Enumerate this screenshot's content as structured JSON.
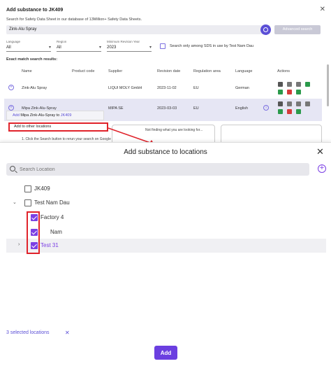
{
  "background": {
    "title": "Add substance to JK409",
    "subtitle": "Search for Safety Data Sheet in our database of 13Million+ Safety Data Sheets.",
    "search_value": "Zink-Alu Spray",
    "advanced_search_label": "Advanced search",
    "filters": [
      {
        "label": "Language",
        "value": "All"
      },
      {
        "label": "Region",
        "value": "All"
      },
      {
        "label": "Minimum Revision Year",
        "value": "2023"
      }
    ],
    "only_sds_label": "Search only among SDS in use by Test Nam Dau",
    "exact_match_label": "Exact match search results:",
    "table_headers": [
      "Name",
      "Product code",
      "Supplier",
      "Revision date",
      "Regulation area",
      "Language",
      "Actions"
    ],
    "rows": [
      {
        "name": "Zink-Alu Spray",
        "product_code": "",
        "supplier": "LIQUI MOLY GmbH",
        "revision_date": "2023-11-02",
        "regulation_area": "EU",
        "language": "German"
      },
      {
        "name": "Mipa Zink-Alu-Spray",
        "product_code": "",
        "supplier": "MIPA SE",
        "revision_date": "2023-03-03",
        "regulation_area": "EU",
        "language": "English"
      }
    ],
    "menu_add_prefix": "Add",
    "menu_add_substance": "Mipa Zink-Alu-Spray to",
    "menu_add_target": "JK409",
    "add_to_other_locations": "Add to other locations",
    "search_hint": "1. Click the Search button to rerun your search on Google",
    "not_finding": "Not finding what you are looking for..."
  },
  "dialog": {
    "title": "Add substance to locations",
    "search_placeholder": "Search Location",
    "tree": [
      {
        "label": "JK409",
        "checked": false,
        "expanded": null
      },
      {
        "label": "Test Nam Dau",
        "checked": false,
        "expanded": true
      },
      {
        "label": "Factory 4",
        "checked": true,
        "expanded": null
      },
      {
        "label": "Nam",
        "checked": true,
        "expanded": null
      },
      {
        "label": "Test 31",
        "checked": true,
        "expanded": false
      }
    ],
    "selected_count_label": "3 selected locations",
    "add_button_label": "Add"
  },
  "colors": {
    "accent": "#6b3fe0",
    "highlight_border": "#e0232b"
  }
}
